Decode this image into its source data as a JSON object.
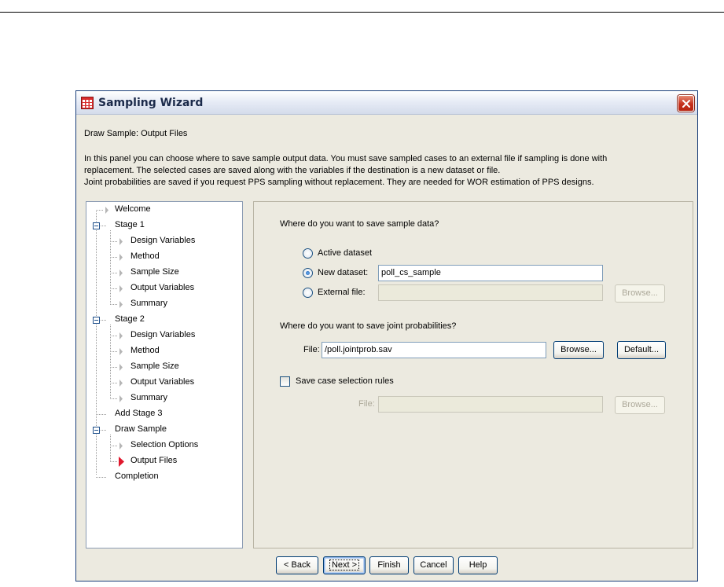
{
  "window": {
    "title": "Sampling Wizard"
  },
  "subtitle": "Draw Sample: Output Files",
  "description": [
    "In this panel you can choose where to save sample output data. You must save sampled cases to an external file if sampling is done with",
    "replacement. The selected cases are saved along with the variables if the destination is a new dataset or file.",
    "Joint probabilities are saved if you request PPS sampling without replacement. They are needed for WOR estimation of PPS designs."
  ],
  "tree": [
    {
      "label": "Welcome"
    },
    {
      "label": "Stage 1"
    },
    {
      "label": "Design Variables"
    },
    {
      "label": "Method"
    },
    {
      "label": "Sample Size"
    },
    {
      "label": "Output Variables"
    },
    {
      "label": "Summary"
    },
    {
      "label": "Stage 2"
    },
    {
      "label": "Design Variables"
    },
    {
      "label": "Method"
    },
    {
      "label": "Sample Size"
    },
    {
      "label": "Output Variables"
    },
    {
      "label": "Summary"
    },
    {
      "label": "Add Stage 3"
    },
    {
      "label": "Draw Sample"
    },
    {
      "label": "Selection Options"
    },
    {
      "label": "Output Files"
    },
    {
      "label": "Completion"
    }
  ],
  "panel": {
    "q1": "Where do you want to save sample data?",
    "active_dataset": "Active dataset",
    "new_dataset": "New dataset:",
    "new_dataset_value": "poll_cs_sample",
    "external_file": "External file:",
    "external_file_value": "",
    "browse": "Browse...",
    "q2": "Where do you want to save joint probabilities?",
    "file_label": "File:",
    "joint_file_value": "/poll.jointprob.sav",
    "default": "Default...",
    "save_rules": "Save case selection rules",
    "rules_file_value": ""
  },
  "footer": {
    "back": "< Back",
    "next": "Next >",
    "finish": "Finish",
    "cancel": "Cancel",
    "help": "Help"
  }
}
